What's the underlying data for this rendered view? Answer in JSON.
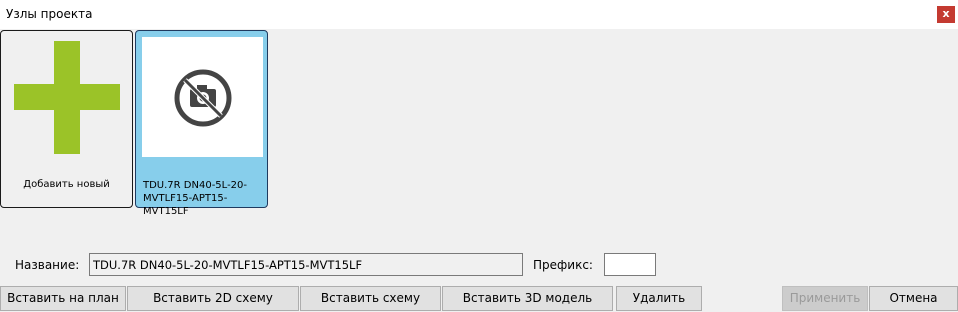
{
  "window": {
    "title": "Узлы проекта",
    "close_label": "x"
  },
  "tiles": {
    "add_new": {
      "label": "Добавить новый",
      "icon": "plus-icon",
      "icon_color": "#9bc328"
    },
    "item": {
      "label": "TDU.7R DN40-5L-20-MVTLF15-APT15-MVT15LF",
      "icon": "no-photo-icon",
      "selected_color": "#87ceeb"
    }
  },
  "form": {
    "name_label": "Название:",
    "name_value": "TDU.7R DN40-5L-20-MVTLF15-APT15-MVT15LF",
    "prefix_label": "Префикс:",
    "prefix_value": ""
  },
  "buttons": {
    "insert_on_plan": "Вставить на план",
    "insert_2d": "Вставить 2D схему",
    "insert_scheme": "Вставить схему",
    "insert_3d": "Вставить 3D модель",
    "delete": "Удалить",
    "apply": "Применить",
    "cancel": "Отмена"
  }
}
